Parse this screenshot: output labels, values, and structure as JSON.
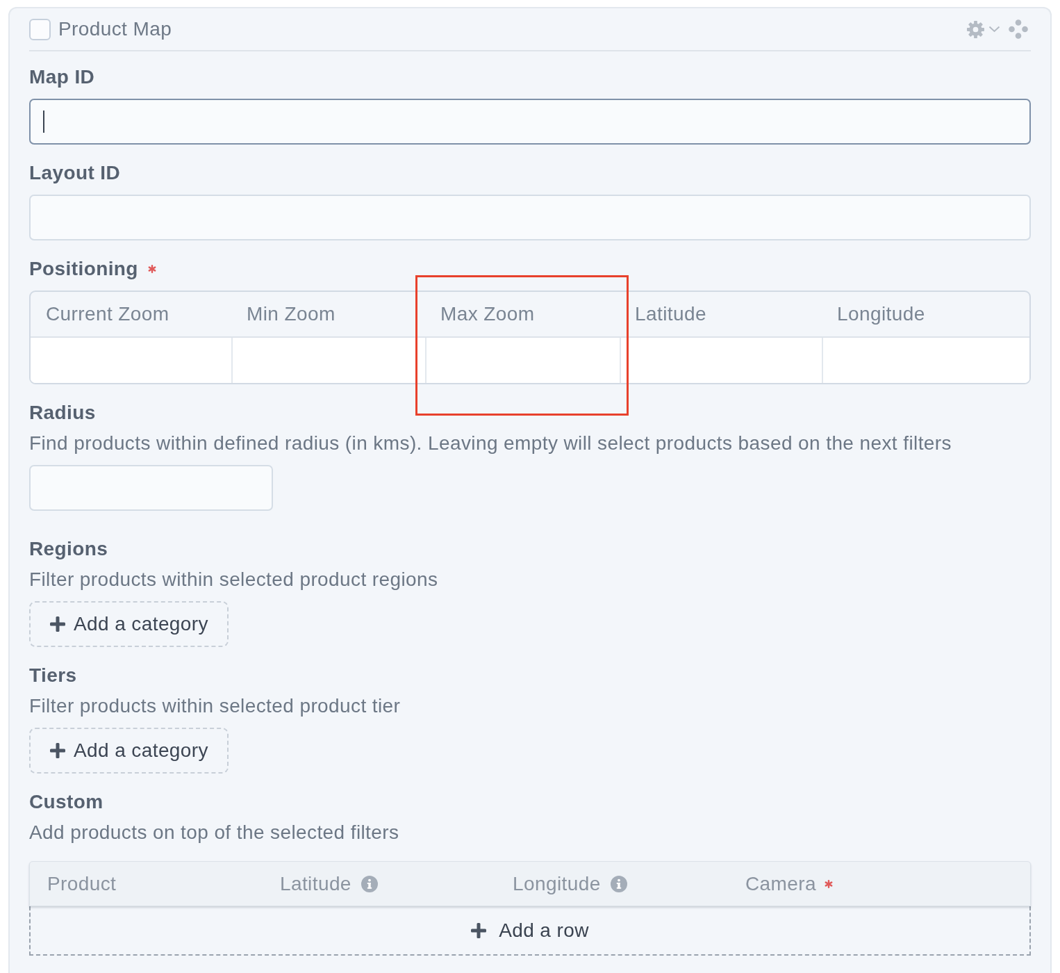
{
  "panel": {
    "title": "Product Map",
    "checked": false
  },
  "fields": [
    {
      "kind": "text",
      "label": "Map ID",
      "required": false,
      "focused": true
    },
    {
      "kind": "text",
      "label": "Layout ID",
      "required": false,
      "focused": false
    },
    {
      "kind": "grid",
      "label": "Positioning",
      "required": true,
      "columns": [
        {
          "label": "Current Zoom",
          "highlighted": false
        },
        {
          "label": "Min Zoom",
          "highlighted": false
        },
        {
          "label": "Max Zoom",
          "highlighted": true
        },
        {
          "label": "Latitude",
          "highlighted": false
        },
        {
          "label": "Longitude",
          "highlighted": false
        }
      ]
    },
    {
      "kind": "number",
      "label": "Radius",
      "required": false,
      "description": "Find products within defined radius (in kms). Leaving empty will select products based on the next filters",
      "focused": false
    },
    {
      "kind": "categories",
      "label": "Regions",
      "required": false,
      "description": "Filter products within selected product regions",
      "button": "Add a category"
    },
    {
      "kind": "categories",
      "label": "Tiers",
      "required": false,
      "description": "Filter products within selected product tier",
      "button": "Add a category"
    },
    {
      "kind": "repeater",
      "label": "Custom",
      "required": false,
      "description": "Add products on top of the selected filters",
      "columns": [
        {
          "label": "Product",
          "info": false,
          "required": false
        },
        {
          "label": "Latitude",
          "info": true,
          "required": false
        },
        {
          "label": "Longitude",
          "info": true,
          "required": false
        },
        {
          "label": "Camera",
          "info": false,
          "required": true
        }
      ],
      "button": "Add a row"
    }
  ]
}
